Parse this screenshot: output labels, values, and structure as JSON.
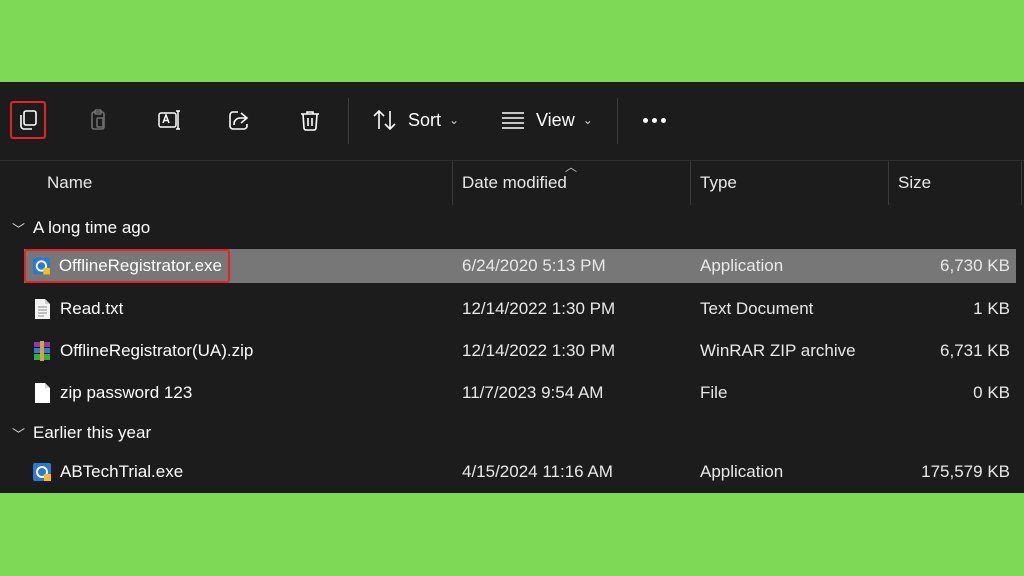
{
  "toolbar": {
    "sort_label": "Sort",
    "view_label": "View"
  },
  "columns": {
    "name": "Name",
    "date": "Date modified",
    "type": "Type",
    "size": "Size"
  },
  "groups": [
    {
      "label": "A long time ago",
      "files": [
        {
          "name": "OfflineRegistrator.exe",
          "date": "6/24/2020 5:13 PM",
          "type": "Application",
          "size": "6,730 KB",
          "icon": "app-icon",
          "selected": true
        },
        {
          "name": "Read.txt",
          "date": "12/14/2022 1:30 PM",
          "type": "Text Document",
          "size": "1 KB",
          "icon": "text-file-icon"
        },
        {
          "name": "OfflineRegistrator(UA).zip",
          "date": "12/14/2022 1:30 PM",
          "type": "WinRAR ZIP archive",
          "size": "6,731 KB",
          "icon": "winrar-icon"
        },
        {
          "name": "zip password 123",
          "date": "11/7/2023 9:54 AM",
          "type": "File",
          "size": "0 KB",
          "icon": "blank-file-icon"
        }
      ]
    },
    {
      "label": "Earlier this year",
      "files": [
        {
          "name": "ABTechTrial.exe",
          "date": "4/15/2024 11:16 AM",
          "type": "Application",
          "size": "175,579 KB",
          "icon": "app-icon"
        }
      ]
    }
  ],
  "colors": {
    "background": "#7ed957",
    "window": "#1c1c1c",
    "selected_row": "#777777",
    "highlight": "#e8202a"
  }
}
